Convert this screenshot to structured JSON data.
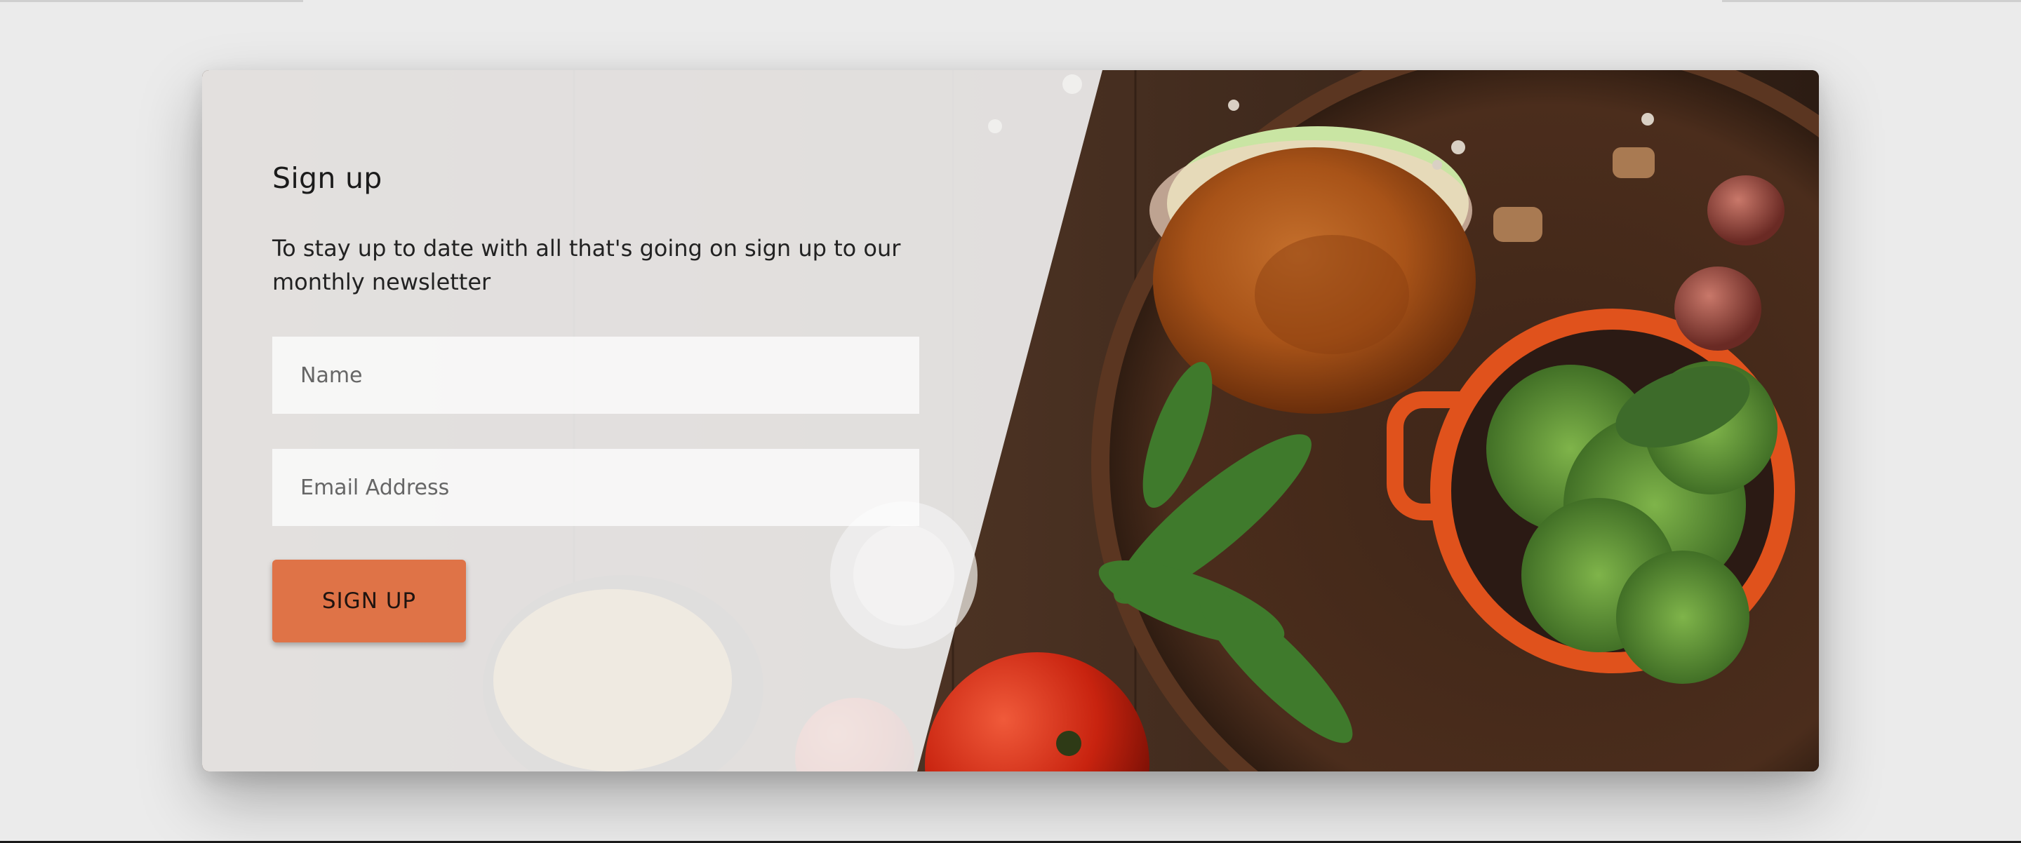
{
  "signup": {
    "title": "Sign up",
    "description": "To stay up to date with all that's going on sign up to our monthly newsletter",
    "name_placeholder": "Name",
    "email_placeholder": "Email Address",
    "button_label": "SIGN UP"
  },
  "colors": {
    "page_background": "#ebebeb",
    "button": "#df7347",
    "overlay": "#f2f2f2"
  },
  "image": {
    "subject": "burger-and-salad-photo"
  }
}
